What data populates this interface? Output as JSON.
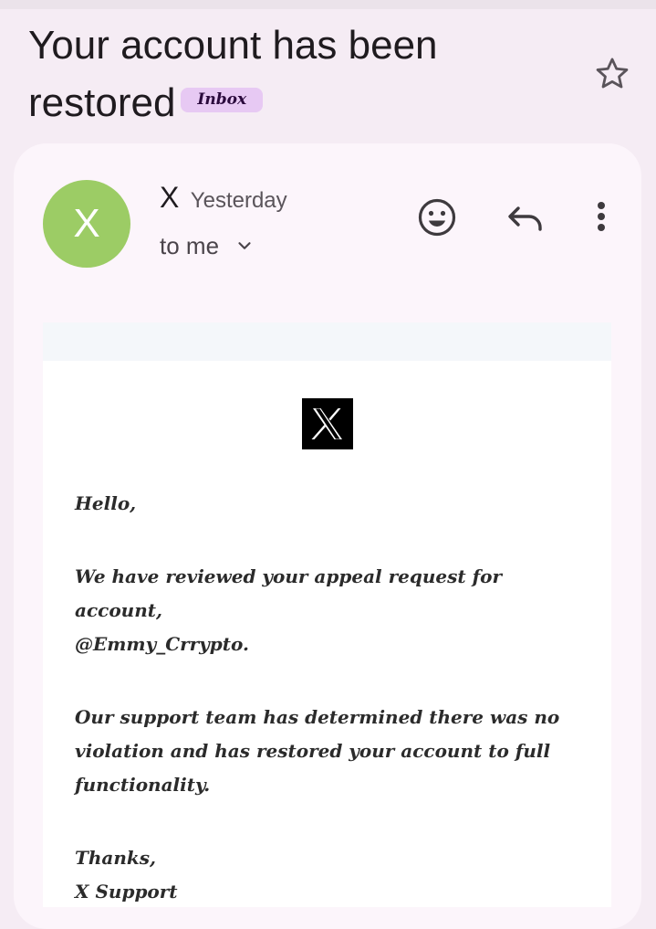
{
  "email": {
    "subject_line1": "Your account has been",
    "subject_line2": "restored",
    "label": "Inbox",
    "sender": {
      "initial": "X",
      "name": "X",
      "time": "Yesterday",
      "recipient": "to me"
    },
    "body": {
      "greeting": "Hello,",
      "para1_line1": "We have reviewed your appeal request for account,",
      "para1_line2": "@Emmy_Crrypto.",
      "para2_line1": "Our support team has determined there was no",
      "para2_line2": "violation and has restored your account to full",
      "para2_line3": "functionality.",
      "signoff": "Thanks,",
      "signature": "X Support"
    }
  },
  "icons": {
    "star": "star-outline-icon",
    "emoji": "add-reaction-icon",
    "reply": "reply-icon",
    "more": "more-vert-icon",
    "expand": "chevron-down-icon",
    "logo": "x-logo"
  },
  "colors": {
    "background": "#f5ecf4",
    "card": "#fcf5fb",
    "avatar": "#9ccc65",
    "label_chip": "#e7c9f3"
  }
}
